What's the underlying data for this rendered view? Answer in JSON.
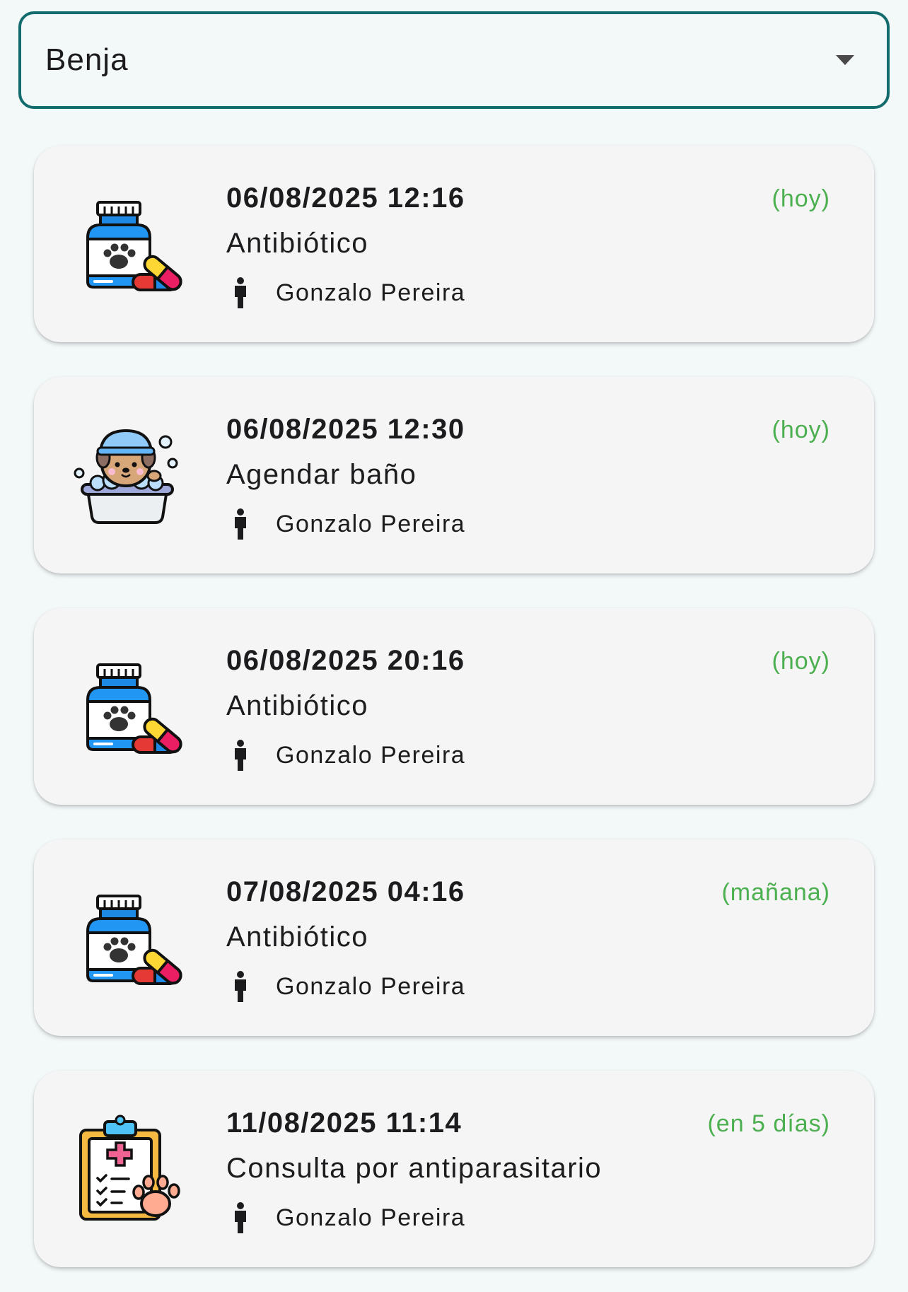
{
  "pet_selector": {
    "selected": "Benja",
    "icon": "arrow-drop-down-icon"
  },
  "colors": {
    "accent_border": "#126b6d",
    "relative_date": "#4caf50",
    "card_background": "#f5f5f5",
    "page_background": "#f3f8f9"
  },
  "reminders": [
    {
      "datetime": "06/08/2025 12:16",
      "relative": "(hoy)",
      "title": "Antibiótico",
      "person": "Gonzalo Pereira",
      "icon": "medicine-bottle-icon"
    },
    {
      "datetime": "06/08/2025 12:30",
      "relative": "(hoy)",
      "title": "Agendar baño",
      "person": "Gonzalo Pereira",
      "icon": "dog-bath-icon"
    },
    {
      "datetime": "06/08/2025 20:16",
      "relative": "(hoy)",
      "title": "Antibiótico",
      "person": "Gonzalo Pereira",
      "icon": "medicine-bottle-icon"
    },
    {
      "datetime": "07/08/2025 04:16",
      "relative": "(mañana)",
      "title": "Antibiótico",
      "person": "Gonzalo Pereira",
      "icon": "medicine-bottle-icon"
    },
    {
      "datetime": "11/08/2025 11:14",
      "relative": "(en 5 días)",
      "title": "Consulta por antiparasitario",
      "person": "Gonzalo Pereira",
      "icon": "vet-clipboard-icon"
    }
  ]
}
